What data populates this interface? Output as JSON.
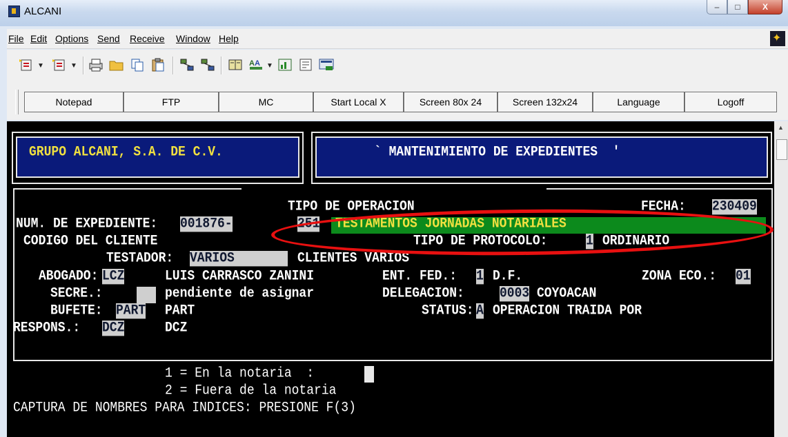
{
  "window": {
    "title": "ALCANI",
    "minimize": "–",
    "maximize": "□",
    "close": "X"
  },
  "menu": [
    "File",
    "Edit",
    "Options",
    "Send",
    "Receive",
    "Window",
    "Help"
  ],
  "toolbar_icons": [
    "new-session-icon",
    "open-session-icon",
    "print-icon",
    "open-folder-icon",
    "copy-icon",
    "paste-icon",
    "network-icon",
    "network2-icon",
    "macro-icon",
    "font-icon",
    "chart-icon",
    "properties-icon",
    "screen-capture-icon"
  ],
  "buttons": [
    "Notepad",
    "FTP",
    "MC",
    "Start Local X",
    "Screen 80x 24",
    "Screen 132x24",
    "Language",
    "Logoff"
  ],
  "colors": {
    "terminal_bg": "#000000",
    "header_blue": "#0a1a7a",
    "field_green": "#0c8a1c",
    "annotation_red": "#e81010"
  },
  "terminal": {
    "company": "GRUPO ALCANI, S.A. DE C.V.",
    "screen_title": "` MANTENIMIENTO DE EXPEDIENTES  '",
    "tipo_operacion_label": "TIPO DE OPERACION",
    "fecha_label": "FECHA:",
    "fecha_value": "230409",
    "num_expediente_label": "NUM. DE EXPEDIENTE:",
    "num_expediente_value": "001876-",
    "operation_code": "251",
    "operation_desc": "TESTAMENTOS JORNADAS NOTARIALES",
    "codigo_cliente_label": "CODIGO DEL CLIENTE",
    "tipo_protocolo_label": "TIPO DE PROTOCOLO:",
    "tipo_protocolo_code": "1",
    "tipo_protocolo_desc": "ORDINARIO",
    "testador_label": "TESTADOR:",
    "testador_value": "VARIOS",
    "testador_desc": "CLIENTES VARIOS",
    "abogado_label": "ABOGADO:",
    "abogado_code": "LCZ",
    "abogado_name": "LUIS CARRASCO ZANINI",
    "ent_fed_label": "ENT. FED.:",
    "ent_fed_code": "1",
    "ent_fed_desc": "D.F.",
    "zona_eco_label": "ZONA ECO.:",
    "zona_eco_value": "01",
    "secre_label": "SECRE.:",
    "secre_desc": "pendiente de asignar",
    "delegacion_label": "DELEGACION:",
    "delegacion_code": "0003",
    "delegacion_desc": "COYOACAN",
    "bufete_label": "BUFETE:",
    "bufete_code": "PART",
    "bufete_desc": "PART",
    "status_label": "STATUS:",
    "status_code": "A",
    "status_desc": "OPERACION TRAIDA POR",
    "respons_label": "RESPONS.:",
    "respons_code": "DCZ",
    "respons_desc": "DCZ",
    "option1": "1 = En la notaria  :",
    "option2": "2 = Fuera de la notaria",
    "footer": "CAPTURA DE NOMBRES PARA INDICES: PRESIONE F(3)"
  }
}
